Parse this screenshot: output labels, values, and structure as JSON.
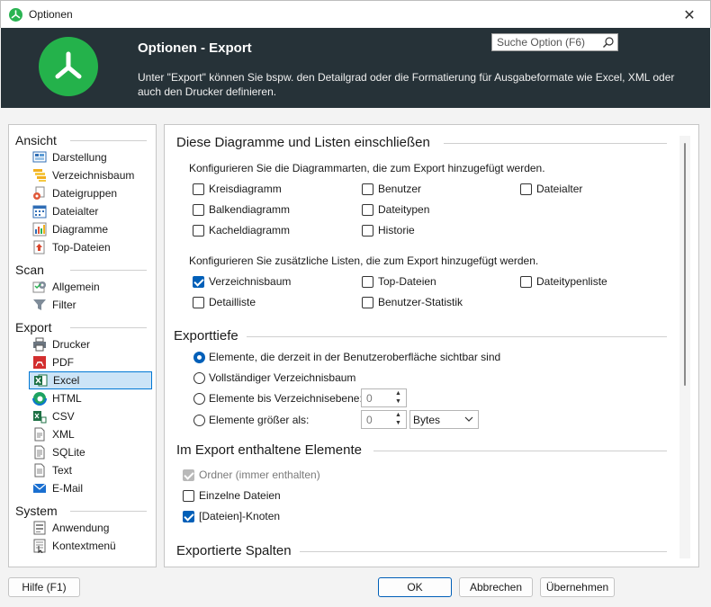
{
  "window": {
    "title": "Optionen",
    "close_glyph": "✕"
  },
  "header": {
    "title": "Optionen - Export",
    "description": "Unter \"Export\" können Sie bspw. den Detailgrad oder die Formatierung für Ausgabeformate wie Excel, XML oder auch den Drucker definieren.",
    "search_placeholder": "Suche Option (F6)"
  },
  "sidebar": {
    "groups": [
      {
        "title": "Ansicht",
        "items": [
          {
            "label": "Darstellung",
            "icon": "display-icon"
          },
          {
            "label": "Verzeichnisbaum",
            "icon": "tree-icon"
          },
          {
            "label": "Dateigruppen",
            "icon": "filegroups-icon"
          },
          {
            "label": "Dateialter",
            "icon": "calendar-icon"
          },
          {
            "label": "Diagramme",
            "icon": "chart-icon"
          },
          {
            "label": "Top-Dateien",
            "icon": "top-files-icon"
          }
        ]
      },
      {
        "title": "Scan",
        "items": [
          {
            "label": "Allgemein",
            "icon": "settings-icon"
          },
          {
            "label": "Filter",
            "icon": "filter-icon"
          }
        ]
      },
      {
        "title": "Export",
        "items": [
          {
            "label": "Drucker",
            "icon": "printer-icon"
          },
          {
            "label": "PDF",
            "icon": "pdf-icon"
          },
          {
            "label": "Excel",
            "icon": "excel-icon",
            "selected": true
          },
          {
            "label": "HTML",
            "icon": "html-icon"
          },
          {
            "label": "CSV",
            "icon": "csv-icon"
          },
          {
            "label": "XML",
            "icon": "xml-icon"
          },
          {
            "label": "SQLite",
            "icon": "sqlite-icon"
          },
          {
            "label": "Text",
            "icon": "text-icon"
          },
          {
            "label": "E-Mail",
            "icon": "email-icon"
          }
        ]
      },
      {
        "title": "System",
        "items": [
          {
            "label": "Anwendung",
            "icon": "application-icon"
          },
          {
            "label": "Kontextmenü",
            "icon": "context-menu-icon"
          }
        ]
      }
    ]
  },
  "content": {
    "section1": {
      "title": "Diese Diagramme und Listen einschließen",
      "diagrams_intro": "Konfigurieren Sie die Diagrammarten, die zum Export hinzugefügt werden.",
      "diagrams": [
        {
          "label": "Kreisdiagramm",
          "checked": false
        },
        {
          "label": "Benutzer",
          "checked": false
        },
        {
          "label": "Dateialter",
          "checked": false
        },
        {
          "label": "Balkendiagramm",
          "checked": false
        },
        {
          "label": "Dateitypen",
          "checked": false
        },
        {
          "label": "Kacheldiagramm",
          "checked": false
        },
        {
          "label": "Historie",
          "checked": false
        }
      ],
      "lists_intro": "Konfigurieren Sie zusätzliche Listen, die zum Export hinzugefügt werden.",
      "lists": [
        {
          "label": "Verzeichnisbaum",
          "checked": true
        },
        {
          "label": "Top-Dateien",
          "checked": false
        },
        {
          "label": "Dateitypenliste",
          "checked": false
        },
        {
          "label": "Detailliste",
          "checked": false
        },
        {
          "label": "Benutzer-Statistik",
          "checked": false
        }
      ]
    },
    "section2": {
      "title": "Exporttiefe",
      "options": [
        {
          "label": "Elemente, die derzeit in der Benutzeroberfläche sichtbar sind",
          "selected": true
        },
        {
          "label": "Vollständiger Verzeichnisbaum",
          "selected": false
        },
        {
          "label": "Elemente bis Verzeichnisebene:",
          "selected": false
        },
        {
          "label": "Elemente größer als:",
          "selected": false
        }
      ],
      "level_value": "0",
      "size_value": "0",
      "size_unit": "Bytes"
    },
    "section3": {
      "title": "Im Export enthaltene Elemente",
      "items": [
        {
          "label": "Ordner (immer enthalten)",
          "checked": true,
          "disabled": true
        },
        {
          "label": "Einzelne Dateien",
          "checked": false
        },
        {
          "label": "[Dateien]-Knoten",
          "checked": true
        }
      ]
    },
    "section4": {
      "title": "Exportierte Spalten"
    }
  },
  "buttons": {
    "help": "Hilfe (F1)",
    "ok": "OK",
    "cancel": "Abbrechen",
    "apply": "Übernehmen"
  }
}
